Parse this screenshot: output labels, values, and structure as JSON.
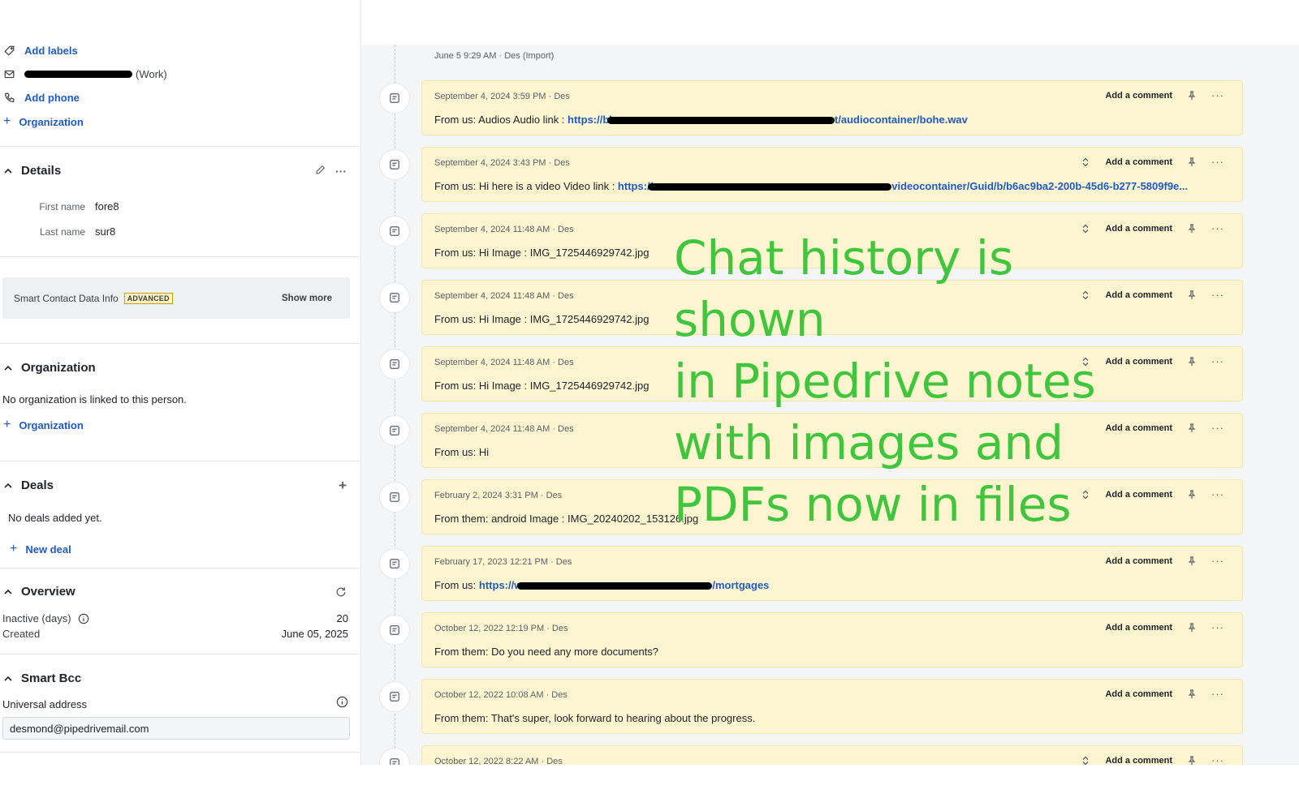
{
  "contact": {
    "add_labels": "Add labels",
    "email_type": "(Work)",
    "add_phone": "Add phone",
    "add_organization": "Organization"
  },
  "details": {
    "title": "Details",
    "first_name_label": "First name",
    "first_name": "fore8",
    "last_name_label": "Last name",
    "last_name": "sur8"
  },
  "smart_contact": {
    "label": "Smart Contact Data Info",
    "badge": "ADVANCED",
    "show_more": "Show more"
  },
  "organization": {
    "title": "Organization",
    "empty_text": "No organization is linked to this person.",
    "add_link": "Organization"
  },
  "deals": {
    "title": "Deals",
    "add_symbol": "+",
    "empty_text": "No deals added yet.",
    "new_deal": "New deal"
  },
  "overview": {
    "title": "Overview",
    "inactive_label": "Inactive (days)",
    "inactive_value": "20",
    "created_label": "Created",
    "created_value": "June 05, 2025"
  },
  "smart_bcc": {
    "title": "Smart Bcc",
    "universal_label": "Universal address",
    "email": "desmond@pipedrivemail.com"
  },
  "timeline": {
    "import_line": "June 5 9:29 AM · Des (Import)",
    "add_comment_label": "Add a comment",
    "notes": [
      {
        "meta": "September 4, 2024 3:59 PM · Des",
        "prefix": "From us: Audios Audio link : ",
        "url_start": "https://bl",
        "url_end": "t/audiocontainer/bohe.wav",
        "text": "",
        "expand": false
      },
      {
        "meta": "September 4, 2024 3:43 PM · Des",
        "prefix": "From us: Hi here is a video Video link : ",
        "url_start": "https://",
        "url_end": "videocontainer/Guid/b/b6ac9ba2-200b-45d6-b277-5809f9e...",
        "text": "",
        "expand": true
      },
      {
        "meta": "September 4, 2024 11:48 AM · Des",
        "prefix": "",
        "url_start": "",
        "url_end": "",
        "text": "From us: Hi Image : IMG_1725446929742.jpg",
        "expand": true
      },
      {
        "meta": "September 4, 2024 11:48 AM · Des",
        "prefix": "",
        "url_start": "",
        "url_end": "",
        "text": "From us: Hi Image : IMG_1725446929742.jpg",
        "expand": true
      },
      {
        "meta": "September 4, 2024 11:48 AM · Des",
        "prefix": "",
        "url_start": "",
        "url_end": "",
        "text": "From us: Hi Image : IMG_1725446929742.jpg",
        "expand": true
      },
      {
        "meta": "September 4, 2024 11:48 AM · Des",
        "prefix": "",
        "url_start": "",
        "url_end": "",
        "text": "From us: Hi",
        "expand": false
      },
      {
        "meta": "February 2, 2024 3:31 PM · Des",
        "prefix": "",
        "url_start": "",
        "url_end": "",
        "text": "From them: android Image : IMG_20240202_153126.jpg",
        "expand": true
      },
      {
        "meta": "February 17, 2023 12:21 PM · Des",
        "prefix": "From us: ",
        "url_start": "https://w",
        "url_end": "/mortgages",
        "text": "",
        "expand": false
      },
      {
        "meta": "October 12, 2022 12:19 PM · Des",
        "prefix": "",
        "url_start": "",
        "url_end": "",
        "text": "From them: Do you need any more documents?",
        "expand": false
      },
      {
        "meta": "October 12, 2022 10:08 AM · Des",
        "prefix": "",
        "url_start": "",
        "url_end": "",
        "text": "From them: That's super, look forward to hearing about the progress.",
        "expand": false
      },
      {
        "meta": "October 12, 2022 8:22 AM · Des",
        "prefix": "",
        "url_start": "",
        "url_end": "",
        "text": "",
        "expand": true
      }
    ]
  },
  "overlay": {
    "lines": [
      "Chat history is shown",
      "in Pipedrive notes",
      "with images and",
      "PDFs now in files"
    ],
    "color": "#3fc63d"
  }
}
